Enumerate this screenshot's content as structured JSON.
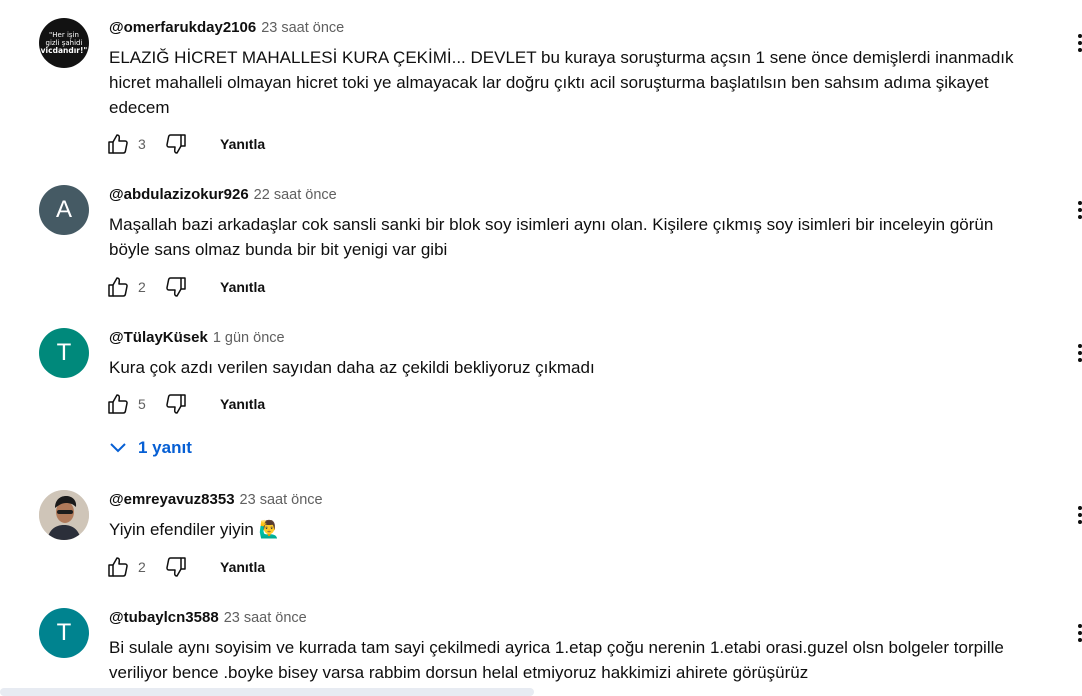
{
  "comments": [
    {
      "author": "@omerfarukday2106",
      "time": "23 saat önce",
      "text_lines": [
        "ELAZIĞ HİCRET MAHALLESİ KURA ÇEKİMİ... DEVLET bu kuraya soruşturma açsın 1 sene önce demişlerdi inanmadık",
        "hicret mahalleli olmayan hicret toki ye almayacak lar doğru çıktı acil soruşturma başlatılsın ben sahsım adıma şikayet",
        "edecem"
      ],
      "likes": "3",
      "reply_label": "Yanıtla",
      "avatar": {
        "type": "image",
        "image_text": [
          "\"Her işin",
          "gizli şahidi",
          "vicdandır!\""
        ],
        "bg": "#121212"
      }
    },
    {
      "author": "@abdulazizokur926",
      "time": "22 saat önce",
      "text_lines": [
        "Maşallah bazi arkadaşlar cok sansli sanki bir blok soy isimleri aynı olan. Kişilere çıkmış soy isimleri bir inceleyin görün",
        "böyle sans olmaz  bunda bir bit yenigi var gibi"
      ],
      "likes": "2",
      "reply_label": "Yanıtla",
      "avatar": {
        "type": "letter",
        "letter": "A",
        "bg": "#455a64"
      }
    },
    {
      "author": "@TülayKüsek",
      "time": "1 gün önce",
      "text_lines": [
        "Kura çok azdı verilen sayıdan daha az çekildi bekliyoruz çıkmadı"
      ],
      "likes": "5",
      "reply_label": "Yanıtla",
      "replies_label": "1 yanıt",
      "avatar": {
        "type": "letter",
        "letter": "T",
        "bg": "#00897b"
      }
    },
    {
      "author": "@emreyavuz8353",
      "time": "23 saat önce",
      "text_lines": [
        "Yiyin efendiler yiyin 🙋‍♂️"
      ],
      "likes": "2",
      "reply_label": "Yanıtla",
      "avatar": {
        "type": "photo",
        "bg": "#d8d0c6"
      }
    },
    {
      "author": "@tubaylcn3588",
      "time": "23 saat önce",
      "text_lines": [
        "Bi sulale aynı soyisim ve kurrada tam sayi çekilmedi ayrica 1.etap çoğu nerenin 1.etabi orasi.guzel olsn bolgeler torpille",
        "veriliyor bence .boyke bisey varsa rabbim dorsun helal etmiyoruz hakkimizi ahirete görüşürüz"
      ],
      "avatar": {
        "type": "letter",
        "letter": "T",
        "bg": "#00838f"
      }
    }
  ],
  "colors": {
    "link_blue": "#065fd4",
    "meta_gray": "#606060",
    "text": "#0f0f0f"
  }
}
